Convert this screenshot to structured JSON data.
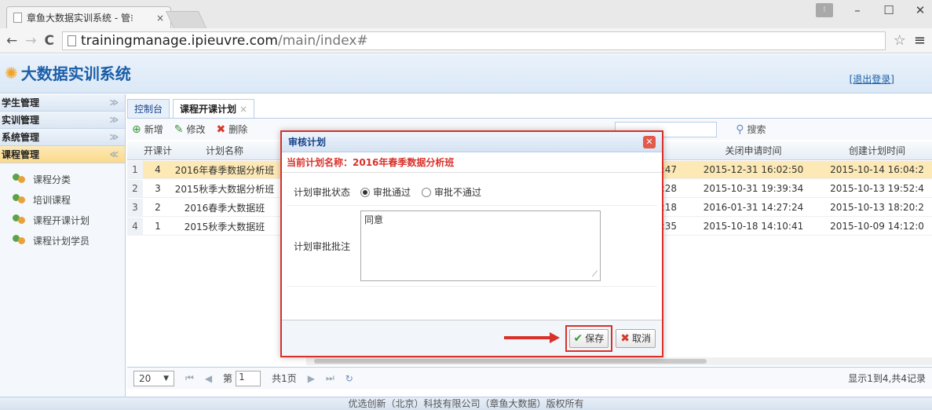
{
  "browser": {
    "tab_title": "章鱼大数据实训系统 - 管理",
    "tab_title_display": "章鱼大数据实训系统 - 管⁝",
    "tab_close": "×",
    "url_host": "trainingmanage.ipieuvre.com",
    "url_path": "/main/index#",
    "profile": "⁝",
    "min": "–",
    "max": "☐",
    "close": "✕",
    "back": "←",
    "forward": "→",
    "reload": "C",
    "star": "☆",
    "menu": "≡"
  },
  "app": {
    "title": "大数据实训系统",
    "logout": "[退出登录]",
    "footer": "优选创新（北京）科技有限公司（章鱼大数据）版权所有"
  },
  "sidebar": {
    "sections": [
      {
        "label": "学生管理",
        "chev": "≫"
      },
      {
        "label": "实训管理",
        "chev": "≫"
      },
      {
        "label": "系统管理",
        "chev": "≫"
      },
      {
        "label": "课程管理",
        "chev": "≪"
      }
    ],
    "items": [
      {
        "label": "课程分类"
      },
      {
        "label": "培训课程"
      },
      {
        "label": "课程开课计划"
      },
      {
        "label": "课程计划学员"
      }
    ]
  },
  "tabs": [
    {
      "label": "控制台"
    },
    {
      "label": "课程开课计划",
      "close": "×"
    }
  ],
  "toolbar": {
    "add": "新增",
    "edit": "修改",
    "delete": "删除",
    "search_label": "搜索"
  },
  "grid": {
    "headers": [
      "",
      "开课计",
      "计划名称",
      "关闭申请时间",
      "创建计划时间"
    ],
    "rows": [
      {
        "n": "1",
        "id": "4",
        "name": "2016年春季数据分析班",
        "hidden_tail": ":47",
        "close_time": "2015-12-31 16:02:50",
        "create_time": "2015-10-14 16:04:2"
      },
      {
        "n": "2",
        "id": "3",
        "name": "2015秋季大数据分析班",
        "hidden_tail": ":28",
        "close_time": "2015-10-31 19:39:34",
        "create_time": "2015-10-13 19:52:4"
      },
      {
        "n": "3",
        "id": "2",
        "name": "2016春季大数据班",
        "hidden_tail": ":18",
        "close_time": "2016-01-31 14:27:24",
        "create_time": "2015-10-13 18:20:2"
      },
      {
        "n": "4",
        "id": "1",
        "name": "2015秋季大数据班",
        "hidden_tail": ":35",
        "close_time": "2015-10-18 14:10:41",
        "create_time": "2015-10-09 14:12:0"
      }
    ]
  },
  "pager": {
    "page_size": "20",
    "page_prefix": "第",
    "page_value": "1",
    "page_total": "共1页",
    "info": "显示1到4,共4记录"
  },
  "dialog": {
    "title": "审核计划",
    "plan_name": "当前计划名称：2016年春季数据分析班",
    "status_label": "计划审批状态",
    "approve": "审批通过",
    "reject": "审批不通过",
    "note_label": "计划审批批注",
    "note_value": "同意",
    "save": "保存",
    "cancel": "取消"
  },
  "colors": {
    "accent_red": "#d9302a",
    "brand_blue": "#1b5ea8",
    "selected_row": "#fde9b6"
  }
}
